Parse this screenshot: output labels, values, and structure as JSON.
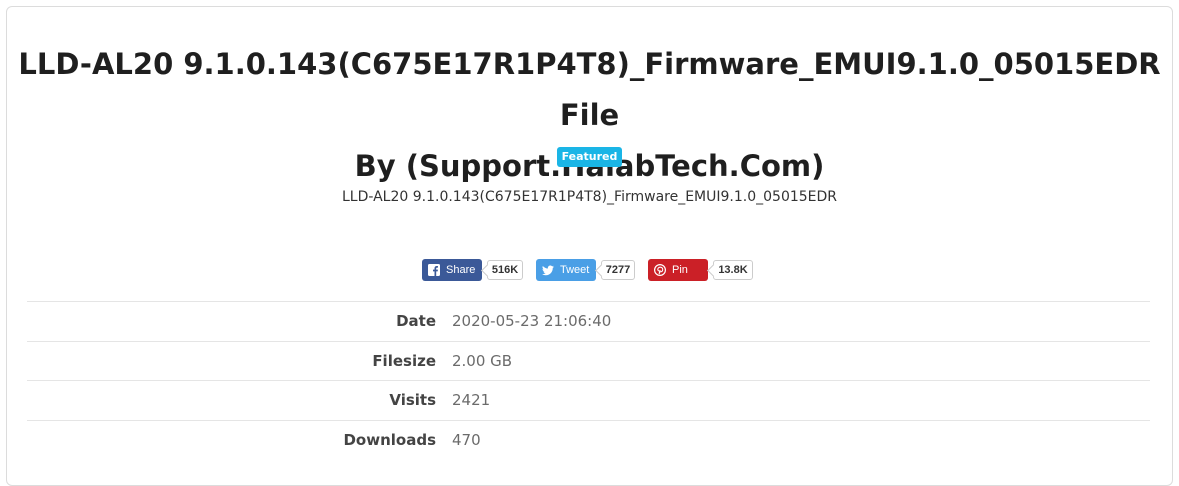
{
  "title": {
    "line1": "LLD-AL20 9.1.0.143(C675E17R1P4T8)_Firmware_EMUI9.1.0_05015EDR File",
    "line2": "By (Support.HalabTech.Com)"
  },
  "badge": "Featured",
  "subtitle": "LLD-AL20 9.1.0.143(C675E17R1P4T8)_Firmware_EMUI9.1.0_05015EDR",
  "share": {
    "facebook": {
      "label": "Share",
      "count": "516K",
      "icon": "facebook-icon",
      "color": "#3b5998"
    },
    "twitter": {
      "label": "Tweet",
      "count": "7277",
      "icon": "twitter-icon",
      "color": "#4a9fe6"
    },
    "pinterest": {
      "label": "Pin",
      "count": "13.8K",
      "icon": "pinterest-icon",
      "color": "#cb2027"
    }
  },
  "details": [
    {
      "label": "Date",
      "value": "2020-05-23 21:06:40"
    },
    {
      "label": "Filesize",
      "value": "2.00 GB"
    },
    {
      "label": "Visits",
      "value": "2421"
    },
    {
      "label": "Downloads",
      "value": "470"
    }
  ]
}
